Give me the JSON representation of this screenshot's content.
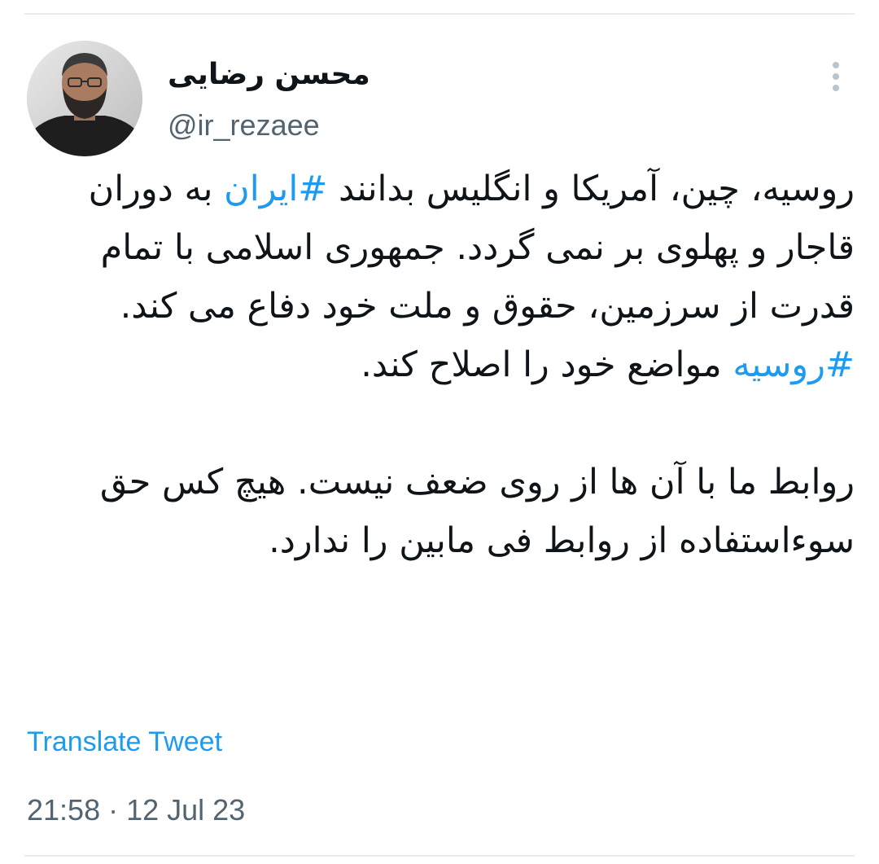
{
  "author": {
    "display_name": "محسن رضایی",
    "handle": "@ir_rezaee"
  },
  "tweet": {
    "paragraph1": {
      "part1": "روسیه، چین، آمریکا و انگلیس بدانند ",
      "hashtag1": "#ایران",
      "part2": " به دوران قاجار و پهلوی بر نمی گردد. جمهوری اسلامی با تمام قدرت از سرزمین، حقوق و ملت خود دفاع می کند. ",
      "hashtag2": "#روسیه",
      "part3": " مواضع خود را اصلاح کند."
    },
    "paragraph2": "روابط ما با آن ها از روی ضعف نیست. هیچ کس حق سوءاستفاده از روابط فی مابین را ندارد."
  },
  "translate_label": "Translate Tweet",
  "timestamp": "21:58 · 12 Jul 23",
  "icons": {
    "menu": "more-vertical-icon"
  },
  "colors": {
    "link": "#1d9bf0",
    "secondary_text": "#536471",
    "primary_text": "#0f1419",
    "divider": "#e6ecf0"
  }
}
